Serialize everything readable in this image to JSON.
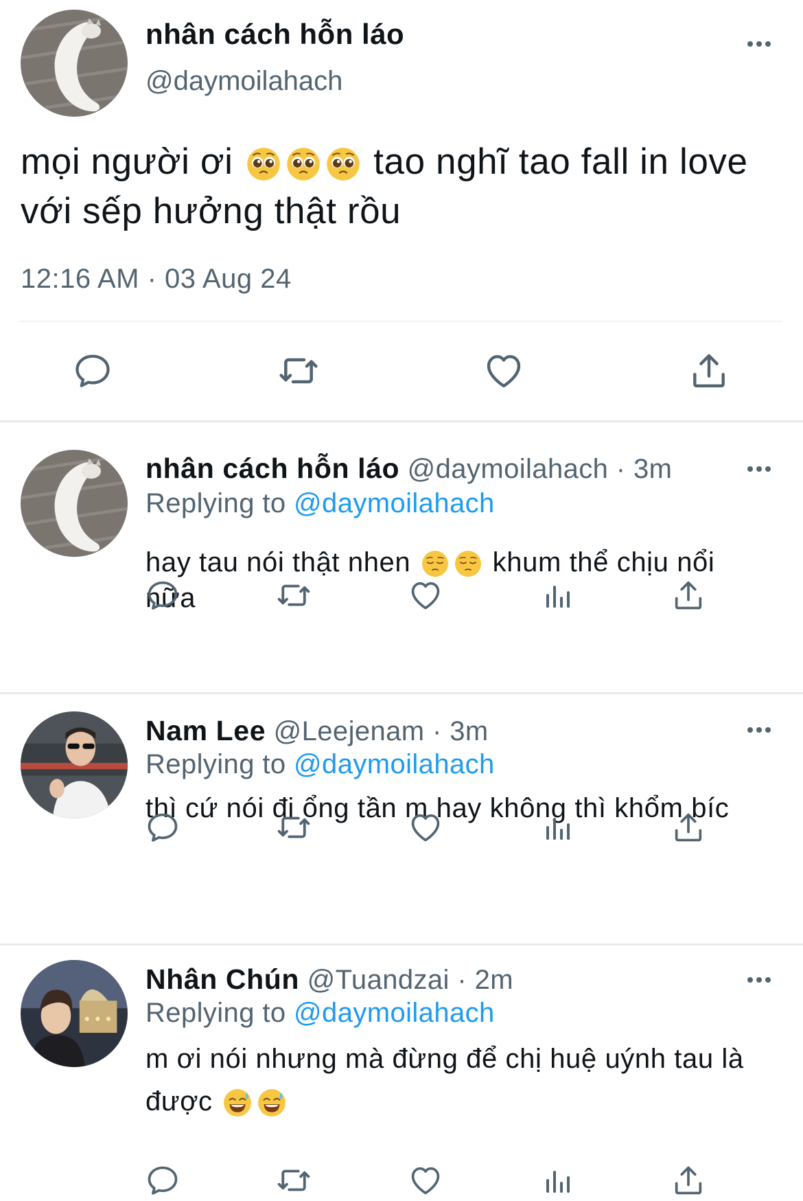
{
  "main_tweet": {
    "author_name": "nhân cách hỗn láo",
    "author_handle": "@daymoilahach",
    "text_part1": "mọi người ơi",
    "text_part2": "tao nghĩ tao fall in love với sếp hưởng thật rồu",
    "emojis": [
      "pleading-face",
      "pleading-face",
      "pleading-face"
    ],
    "timestamp": "12:16 AM · 03 Aug 24",
    "actions": [
      "reply-icon",
      "retweet-icon",
      "like-icon",
      "share-icon"
    ]
  },
  "replies": [
    {
      "author_name": "nhân cách hỗn láo",
      "author_handle": "@daymoilahach",
      "time": "3m",
      "replying_prefix": "Replying to",
      "replying_to": "@daymoilahach",
      "text_part1": "hay tau nói thật nhen",
      "text_part2": "khum thể chịu nổi nữa",
      "emojis": [
        "pensive-face",
        "pensive-face"
      ]
    },
    {
      "author_name": "Nam Lee",
      "author_handle": "@Leejenam",
      "time": "3m",
      "replying_prefix": "Replying to",
      "replying_to": "@daymoilahach",
      "text_part1": "thì cứ nói đi ổng tần m hay không thì khổm bíc",
      "text_part2": "",
      "emojis": []
    },
    {
      "author_name": "Nhân Chún",
      "author_handle": "@Tuandzai",
      "time": "2m",
      "replying_prefix": "Replying to",
      "replying_to": "@daymoilahach",
      "text_part1": "m ơi nói nhưng mà đừng để chị huệ uýnh tau là được",
      "text_part2": "",
      "emojis": [
        "grinning-sweat-face",
        "grinning-sweat-face"
      ]
    }
  ],
  "reply_actions": [
    "reply-icon",
    "retweet-icon",
    "like-icon",
    "views-icon",
    "share-icon"
  ],
  "colors": {
    "text": "#0f1419",
    "secondary": "#536471",
    "link": "#1d9bf0",
    "divider": "#eff3f4"
  }
}
